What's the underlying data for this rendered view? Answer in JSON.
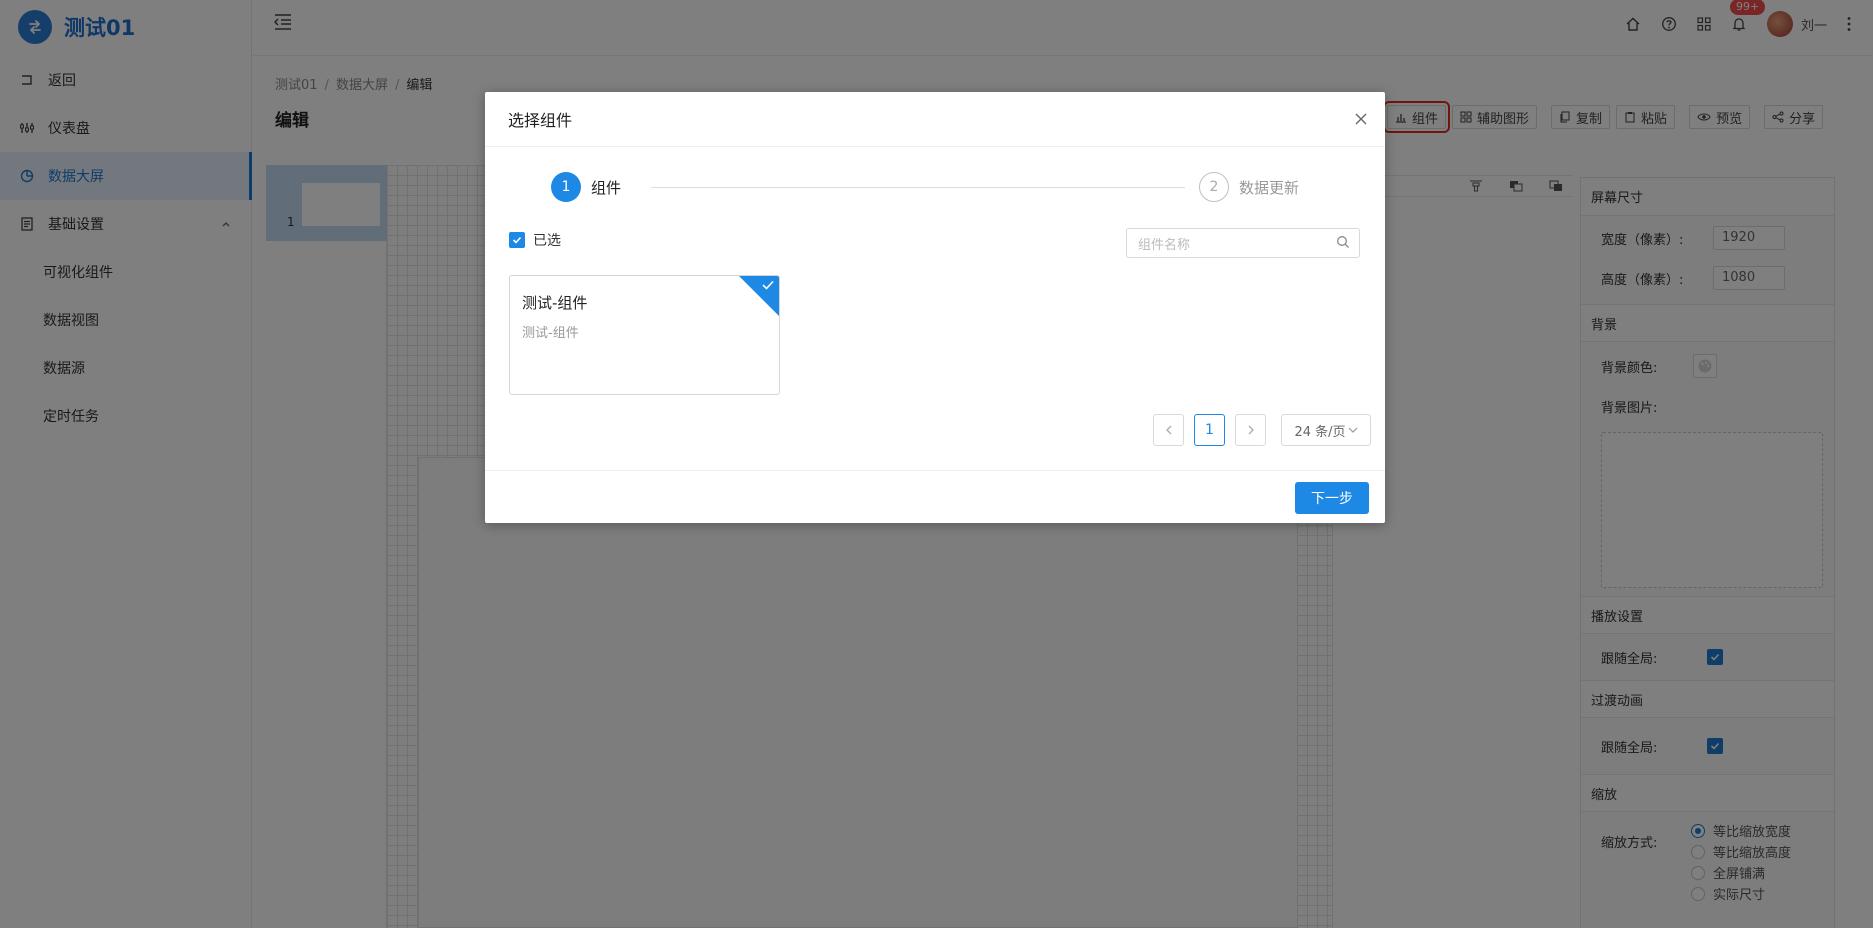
{
  "app": {
    "title": "测试01"
  },
  "sidebar": {
    "items": [
      {
        "label": "返回",
        "icon": "back-icon"
      },
      {
        "label": "仪表盘",
        "icon": "dashboard-icon"
      },
      {
        "label": "数据大屏",
        "icon": "pie-chart-icon",
        "active": true
      },
      {
        "label": "基础设置",
        "icon": "settings-doc-icon",
        "expanded": true
      }
    ],
    "subitems": [
      {
        "label": "可视化组件"
      },
      {
        "label": "数据视图"
      },
      {
        "label": "数据源"
      },
      {
        "label": "定时任务"
      }
    ]
  },
  "header": {
    "badge": "99+",
    "user": "刘一"
  },
  "breadcrumb": [
    "测试01",
    "数据大屏",
    "编辑"
  ],
  "page": {
    "title": "编辑"
  },
  "toolbar": {
    "component": "组件",
    "aux_shape": "辅助图形",
    "copy": "复制",
    "paste": "粘贴",
    "preview": "预览",
    "share": "分享"
  },
  "canvas": {
    "page_number": "1"
  },
  "props": {
    "screen_size": {
      "title": "屏幕尺寸",
      "width_label": "宽度（像素）:",
      "width": "1920",
      "height_label": "高度（像素）:",
      "height": "1080"
    },
    "background": {
      "title": "背景",
      "color_label": "背景颜色:",
      "image_label": "背景图片:"
    },
    "playback": {
      "title": "播放设置",
      "follow_label": "跟随全局:"
    },
    "transition": {
      "title": "过渡动画",
      "follow_label": "跟随全局:"
    },
    "scale": {
      "title": "缩放",
      "mode_label": "缩放方式:",
      "options": [
        "等比缩放宽度",
        "等比缩放高度",
        "全屏铺满",
        "实际尺寸"
      ],
      "selected": "等比缩放宽度"
    }
  },
  "dialog": {
    "title": "选择组件",
    "steps": [
      {
        "num": "1",
        "label": "组件"
      },
      {
        "num": "2",
        "label": "数据更新"
      }
    ],
    "selected_label": "已选",
    "search_placeholder": "组件名称",
    "card": {
      "title": "测试-组件",
      "subtitle": "测试-组件"
    },
    "pagination": {
      "current": "1",
      "page_size": "24 条/页"
    },
    "next": "下一步"
  },
  "colors": {
    "primary": "#1e88e5",
    "highlight": "#e22b22",
    "badge": "#f04c4c"
  }
}
